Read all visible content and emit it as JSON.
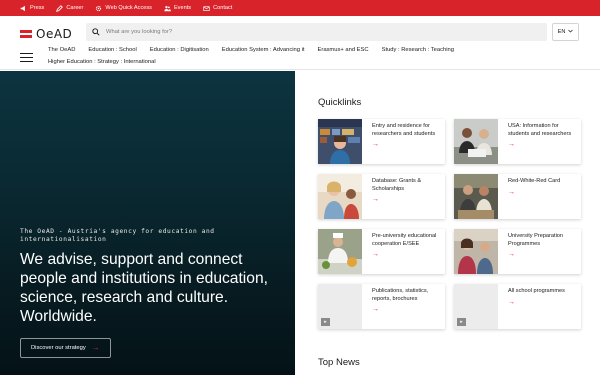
{
  "topbar": {
    "items": [
      {
        "label": "Press",
        "icon": "megaphone-icon"
      },
      {
        "label": "Career",
        "icon": "pencil-icon"
      },
      {
        "label": "Web Quick Access",
        "icon": "gear-icon"
      },
      {
        "label": "Events",
        "icon": "people-icon"
      },
      {
        "label": "Contact",
        "icon": "mail-icon"
      }
    ]
  },
  "header": {
    "logo_text": "OeAD",
    "search_placeholder": "What are you looking for?",
    "language": "EN",
    "nav": [
      "The OeAD",
      "Education : School",
      "Education : Digitisation",
      "Education System : Advancing it",
      "Erasmus+ and ESC",
      "Study : Research : Teaching",
      "Higher Education : Strategy : International"
    ]
  },
  "hero": {
    "subtitle": "The OeAD - Austria's agency for education and internationalisation",
    "title": "We advise, support and connect people and institutions in education, science, research and culture. Worldwide.",
    "button_label": "Discover our strategy"
  },
  "quicklinks": {
    "heading": "Quicklinks",
    "cards": [
      {
        "label": "Entry and residence for researchers and students"
      },
      {
        "label": "USA: Information for students and researchers"
      },
      {
        "label": "Database: Grants & Scholarships"
      },
      {
        "label": "Red-White-Red Card"
      },
      {
        "label": "Pre-university educational cooperation E/SEE"
      },
      {
        "label": "University Preparation Programmes"
      },
      {
        "label": "Publications, statistics, reports, brochures"
      },
      {
        "label": "All school programmes"
      }
    ]
  },
  "top_news": {
    "heading": "Top News"
  },
  "colors": {
    "brand_red": "#d8232a",
    "hero_dark": "#0a2a33"
  }
}
